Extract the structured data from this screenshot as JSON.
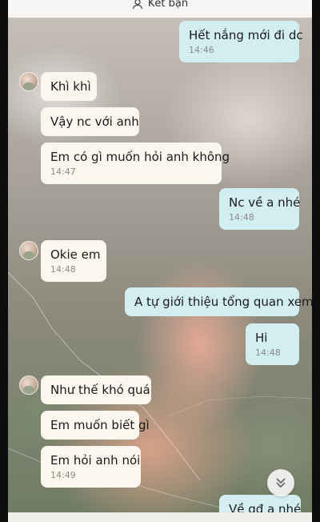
{
  "header": {
    "title": "Kết bạn",
    "icon": "person-icon"
  },
  "messages": [
    {
      "side": "sent",
      "text": "Hết nắng mới đi dc",
      "time": "14:46"
    },
    {
      "side": "recv",
      "text": "Khì khì",
      "time": ""
    },
    {
      "side": "recv",
      "text": "Vậy nc với anh",
      "time": ""
    },
    {
      "side": "recv",
      "text": "Em có gì muốn hỏi anh không",
      "time": "14:47"
    },
    {
      "side": "sent",
      "text": "Nc về a nhé",
      "time": "14:48"
    },
    {
      "side": "recv",
      "text": "Okie em",
      "time": "14:48"
    },
    {
      "side": "sent",
      "text": "A tự giới thiệu tổng quan xem",
      "time": ""
    },
    {
      "side": "sent",
      "text": "Hi",
      "time": "14:48"
    },
    {
      "side": "recv",
      "text": "Như thế khó quá",
      "time": ""
    },
    {
      "side": "recv",
      "text": "Em muốn biết gì",
      "time": ""
    },
    {
      "side": "recv",
      "text": "Em hỏi anh nói",
      "time": "14:49"
    },
    {
      "side": "sent",
      "text": "Về gđ a nhé",
      "time": ""
    }
  ],
  "scroll_button": {
    "icon": "double-chevron-down-icon"
  },
  "colors": {
    "received_bubble": "#fbf7ee",
    "sent_bubble": "#d3eef1",
    "timestamp": "#8a8a8a"
  }
}
